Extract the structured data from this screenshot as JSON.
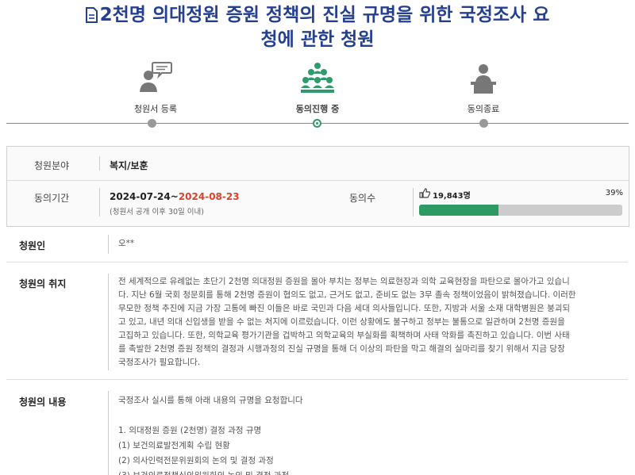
{
  "title": {
    "line1": "2천명 의대정원 증원 정책의 진실 규명을 위한 국정조사 요",
    "line2": "청에 관한 청원"
  },
  "steps": [
    {
      "label": "청원서 등록",
      "icon": "petitioner-speaking-icon"
    },
    {
      "label": "동의진행 중",
      "icon": "group-people-icon"
    },
    {
      "label": "동의종료",
      "icon": "podium-person-icon"
    }
  ],
  "info": {
    "field_label": "청원분야",
    "field_value": "복지/보훈",
    "period_label": "동의기간",
    "period_start": "2024-07-24~",
    "period_end": "2024-08-23",
    "period_note": "(청원서 공개 이후 30일 이내)",
    "agree_label": "동의수",
    "agree_count": "19,843명",
    "agree_percent": "39%",
    "progress": 0.39,
    "colors": {
      "end_date": "#d9442b",
      "bar_fill": "#2e9a63",
      "title": "#25408f"
    }
  },
  "petitioner": {
    "label": "청원인",
    "value": "오**"
  },
  "purpose": {
    "label": "청원의 취지",
    "lines": [
      "전 세계적으로 유례없는 초단기 2천명 의대정원 증원을 몰아 부치는 정부는 의료현장과 의학 교육현장을 파탄으로 몰아가고 있습니",
      "다. 지난 6월 국회 청문회를 통해 2천명 증원이 협의도 없고, 근거도 없고, 준비도 없는 3무 졸속 정책이었음이 밝혀졌습니다. 이러한",
      "무모한 정책 추진에 지금 가장 고통에 빠진 이들은 바로 국민과 다음 세대 의사들입니다. 또한, 지방과 서울 소재 대학병원은 붕괴되",
      "고 있고, 내년 의대 신입생을 받을 수 없는 처지에 이르렀습니다. 이런 상황에도 불구하고 정부는 불통으로 일관하며 2천명 증원을",
      "고집하고 있습니다. 또한, 의학교육 평가기관을 겁박하고 의학교육의 부실화를 획책하며 사태 악화를 촉진하고 있습니다. 이번 사태",
      "를 촉발한 2천명 증원 정책의 결정과 시행과정의 진실 규명을 통해 더 이상의 파탄을 막고 해결의 실마리를 찾기 위해서 지금 당장",
      "국정조사가 필요합니다."
    ]
  },
  "content": {
    "label": "청원의 내용",
    "intro": "국정조사 실시를 통해 아래 내용의 규명을 요청합니다",
    "lines": [
      "1. 의대정원 증원 (2천명) 결정 과정 규명",
      "(1) 보건의료발전계획 수립 현황",
      "(2) 의사인력전문위원회의 논의 및 결정 과정",
      "(3) 보건의료정책심의위원회의 논의 및 결정 과정"
    ]
  }
}
